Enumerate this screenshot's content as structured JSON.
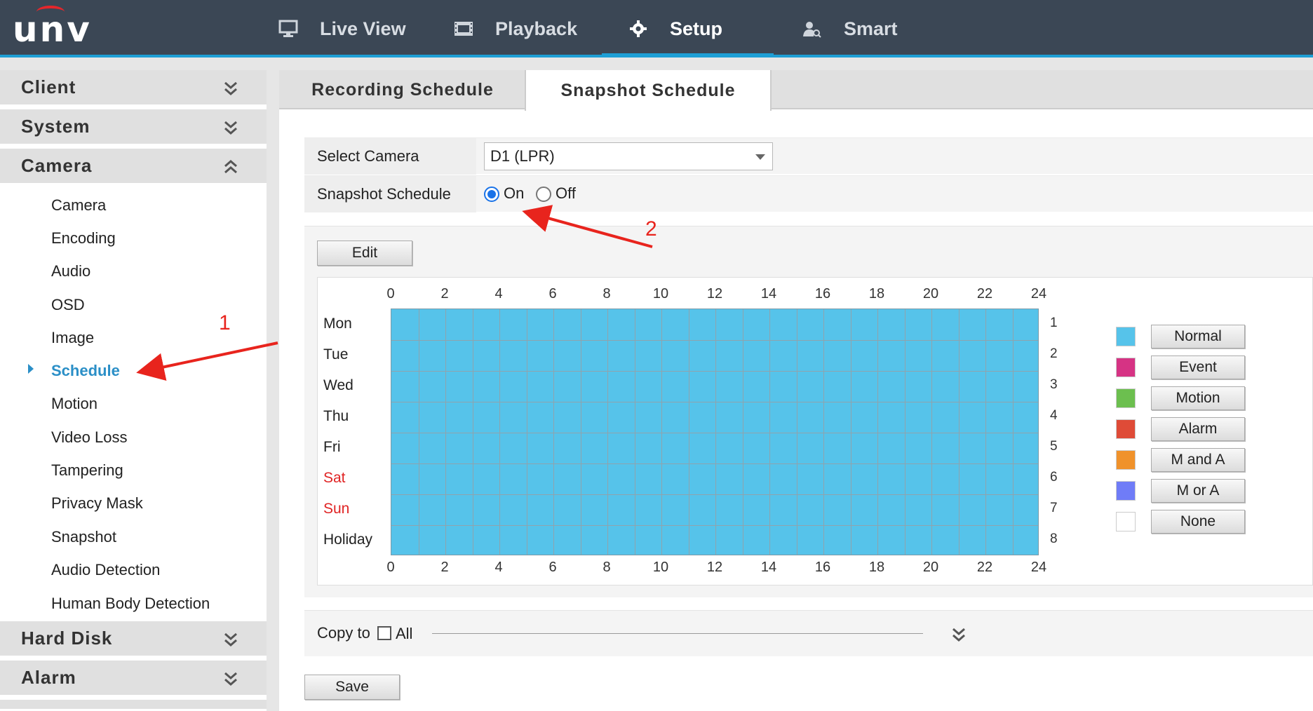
{
  "brand": "UNV",
  "nav": {
    "items": [
      {
        "label": "Live View",
        "icon": "monitor-icon"
      },
      {
        "label": "Playback",
        "icon": "film-icon"
      },
      {
        "label": "Setup",
        "icon": "gear-icon",
        "active": true
      },
      {
        "label": "Smart",
        "icon": "person-search-icon"
      }
    ]
  },
  "sidebar": {
    "sections": [
      "Client",
      "System",
      "Camera",
      "Hard Disk",
      "Alarm"
    ],
    "camera_items": [
      "Camera",
      "Encoding",
      "Audio",
      "OSD",
      "Image",
      "Schedule",
      "Motion",
      "Video Loss",
      "Tampering",
      "Privacy Mask",
      "Snapshot",
      "Audio Detection",
      "Human Body Detection"
    ],
    "active_item": "Schedule"
  },
  "tabs": [
    "Recording Schedule",
    "Snapshot Schedule"
  ],
  "active_tab": "Snapshot Schedule",
  "form": {
    "select_camera_label": "Select Camera",
    "select_camera_value": "D1 (LPR)",
    "snapshot_schedule_label": "Snapshot Schedule",
    "on_label": "On",
    "off_label": "Off",
    "selected": "On"
  },
  "schedule": {
    "edit_label": "Edit",
    "hours": [
      "0",
      "2",
      "4",
      "6",
      "8",
      "10",
      "12",
      "14",
      "16",
      "18",
      "20",
      "22",
      "24"
    ],
    "days": [
      "Mon",
      "Tue",
      "Wed",
      "Thu",
      "Fri",
      "Sat",
      "Sun",
      "Holiday"
    ],
    "row_numbers": [
      "1",
      "2",
      "3",
      "4",
      "5",
      "6",
      "7",
      "8"
    ],
    "fill_color": "#56c3ea",
    "fill_type": "Normal",
    "legend": [
      {
        "label": "Normal",
        "color": "#56c3ea"
      },
      {
        "label": "Event",
        "color": "#d63384"
      },
      {
        "label": "Motion",
        "color": "#6cbf4f"
      },
      {
        "label": "Alarm",
        "color": "#df4b37"
      },
      {
        "label": "M and A",
        "color": "#f0922b"
      },
      {
        "label": "M or A",
        "color": "#6f7cf7"
      },
      {
        "label": "None",
        "color": "#ffffff"
      }
    ]
  },
  "copy": {
    "label": "Copy to",
    "all_label": "All"
  },
  "save_label": "Save",
  "annotations": [
    "1",
    "2"
  ]
}
